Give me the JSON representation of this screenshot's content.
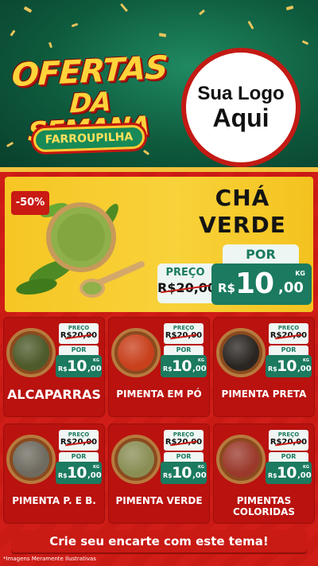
{
  "colors": {
    "header_green": "#0e5a3d",
    "red": "#c91a14",
    "gold": "#f6c624",
    "price_green": "#1b7a5f",
    "title_yellow": "#ffd43a"
  },
  "header": {
    "title_line1": "OFERTAS",
    "title_line2": "DA SEMANA",
    "subtitle": "FARROUPILHA",
    "logo_line1": "Sua Logo",
    "logo_line2": "Aqui"
  },
  "hero": {
    "badge": "-50%",
    "name_line1": "CHÁ",
    "name_line2": "VERDE",
    "preco_label": "PREÇO",
    "old_price": "R$20,00",
    "por_label": "POR",
    "currency": "R$",
    "price_int": "10",
    "price_dec": ",00",
    "unit": "KG"
  },
  "products": [
    {
      "name": "ALCAPARRAS",
      "preco_label": "PREÇO",
      "old_price": "R$20,00",
      "por_label": "POR",
      "currency": "R$",
      "price_int": "10",
      "price_dec": ",00",
      "unit": "KG",
      "fill": "#4d5a2a"
    },
    {
      "name": "PIMENTA EM PÓ",
      "preco_label": "PREÇO",
      "old_price": "R$20,00",
      "por_label": "POR",
      "currency": "R$",
      "price_int": "10",
      "price_dec": ",00",
      "unit": "KG",
      "fill": "#c8401c"
    },
    {
      "name": "PIMENTA PRETA",
      "preco_label": "PREÇO",
      "old_price": "R$20,00",
      "por_label": "POR",
      "currency": "R$",
      "price_int": "10",
      "price_dec": ",00",
      "unit": "KG",
      "fill": "#2a2521"
    },
    {
      "name": "PIMENTA P. E B.",
      "preco_label": "PREÇO",
      "old_price": "R$20,00",
      "por_label": "POR",
      "currency": "R$",
      "price_int": "10",
      "price_dec": ",00",
      "unit": "KG",
      "fill": "#6e6a60"
    },
    {
      "name": "PIMENTA VERDE",
      "preco_label": "PREÇO",
      "old_price": "R$20,00",
      "por_label": "POR",
      "currency": "R$",
      "price_int": "10",
      "price_dec": ",00",
      "unit": "KG",
      "fill": "#8a8e55"
    },
    {
      "name": "PIMENTAS COLORIDAS",
      "preco_label": "PREÇO",
      "old_price": "R$20,00",
      "por_label": "POR",
      "currency": "R$",
      "price_int": "10",
      "price_dec": ",00",
      "unit": "KG",
      "fill": "#9b3a2c"
    }
  ],
  "footer": {
    "banner": "Crie seu encarte com este tema!",
    "disclaimer": "*Imagens Meramente Ilustrativas"
  }
}
